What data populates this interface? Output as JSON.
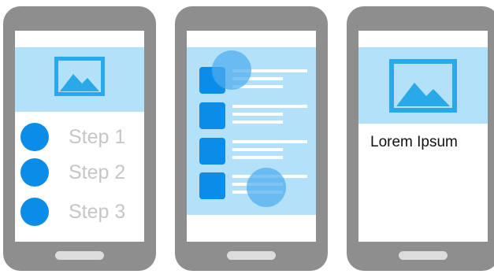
{
  "phones": {
    "steps": {
      "items": [
        {
          "label": "Step 1"
        },
        {
          "label": "Step 2"
        },
        {
          "label": "Step 3"
        }
      ]
    },
    "detail": {
      "body_text": "Lorem Ipsum"
    }
  },
  "colors": {
    "phone_body": "#8e8e8e",
    "screen": "#ffffff",
    "hero_background": "#b3e1f9",
    "accent": "#0a8ce9",
    "image_icon": "#29a8ea",
    "touch_indicator": "#4dacef",
    "step_text": "#c6c6c6"
  },
  "icons": {
    "hero_image": "image-icon",
    "touch": "touch-indicator-icon"
  }
}
